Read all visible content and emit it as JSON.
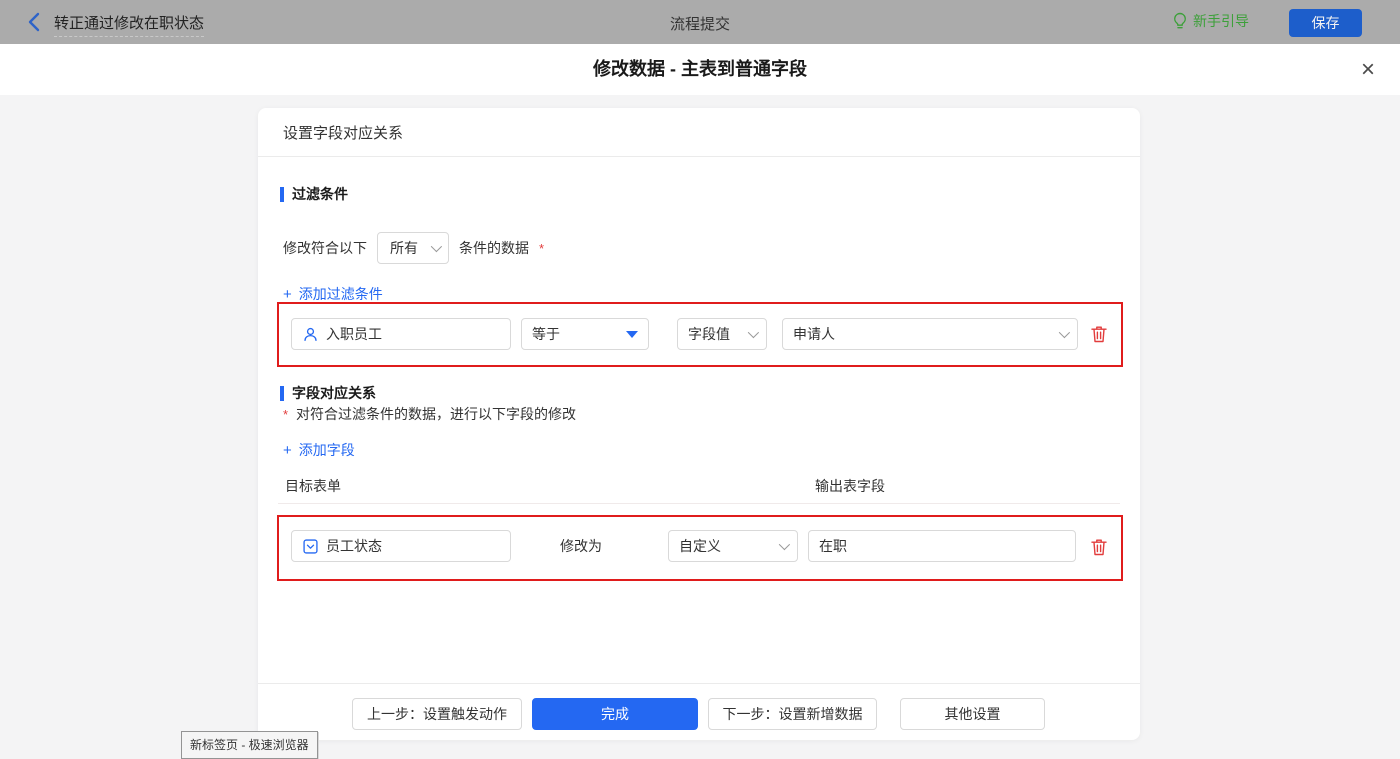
{
  "icons": {
    "plus": "+",
    "close": "×"
  },
  "colors": {
    "primary": "#2468f2",
    "annotation_red": "#e01c1c",
    "danger": "#e23c3c",
    "guide_green": "#3da03a",
    "topbar_bg": "#ababab"
  },
  "topbar": {
    "title": "转正通过修改在职状态",
    "center_title": "流程提交",
    "guide_label": "新手引导",
    "save_label": "保存"
  },
  "dialog": {
    "title": "修改数据 - 主表到普通字段"
  },
  "card": {
    "header": "设置字段对应关系",
    "filter_section": {
      "title": "过滤条件",
      "condition_prefix": "修改符合以下",
      "condition_select_value": "所有",
      "condition_suffix": "条件的数据",
      "required_mark": "*",
      "add_link": "添加过滤条件",
      "row": {
        "field": "入职员工",
        "operator": "等于",
        "value_type": "字段值",
        "value": "申请人"
      }
    },
    "mapping_section": {
      "title": "字段对应关系",
      "required_mark": "*",
      "description": "对符合过滤条件的数据，进行以下字段的修改",
      "add_link": "添加字段",
      "col_target": "目标表单",
      "col_output": "输出表字段",
      "row": {
        "field": "员工状态",
        "action_label": "修改为",
        "value_type": "自定义",
        "value": "在职"
      }
    },
    "footer": {
      "prev_label": "上一步：设置触发动作",
      "done_label": "完成",
      "next_label": "下一步：设置新增数据",
      "other_label": "其他设置"
    }
  },
  "browser_tooltip": "新标签页 - 极速浏览器"
}
